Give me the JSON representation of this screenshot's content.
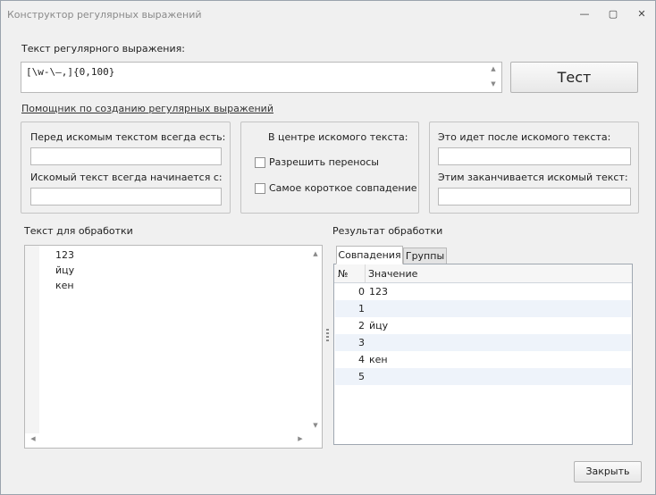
{
  "window": {
    "title": "Конструктор регулярных выражений",
    "minimize_glyph": "—",
    "maximize_glyph": "▢",
    "close_glyph": "✕"
  },
  "regex": {
    "label": "Текст регулярного выражения:",
    "value": "[\\w-\\—,]{0,100}",
    "test_button": "Тест"
  },
  "helper_link": "Помощник по созданию регулярных выражений",
  "before": {
    "label": "Перед искомым текстом всегда есть:",
    "starts_label": "Искомый текст всегда начинается с:"
  },
  "center": {
    "label": "В центре искомого текста:",
    "allow_wrap": "Разрешить переносы",
    "shortest": "Самое короткое совпадение"
  },
  "after": {
    "label": "Это идет после искомого текста:",
    "ends_label": "Этим заканчивается искомый текст:"
  },
  "input_text": {
    "label": "Текст для обработки",
    "lines": [
      "123",
      "йцу",
      "кен"
    ]
  },
  "result": {
    "label": "Результат обработки",
    "tabs": [
      "Совпадения",
      "Группы"
    ],
    "columns": [
      "№",
      "Значение"
    ],
    "rows": [
      {
        "num": "0",
        "value": "123"
      },
      {
        "num": "1",
        "value": ""
      },
      {
        "num": "2",
        "value": "йцу"
      },
      {
        "num": "3",
        "value": ""
      },
      {
        "num": "4",
        "value": "кен"
      },
      {
        "num": "5",
        "value": ""
      }
    ]
  },
  "close_button": "Закрыть"
}
